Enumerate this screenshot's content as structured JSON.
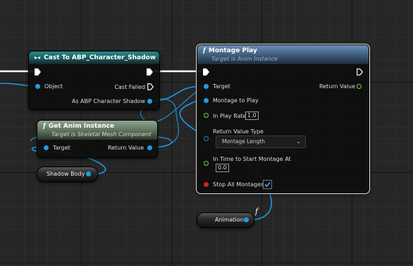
{
  "cast_node": {
    "title": "Cast To ABP_Character_Shadow",
    "object_pin": "Object",
    "cast_failed_pin": "Cast Failed",
    "as_pin": "As ABP Character Shadow",
    "header_icon": "cast-arrows-icon"
  },
  "get_anim_node": {
    "title": "Get Anim Instance",
    "subtitle": "Target is Skeletal Mesh Component",
    "target_pin": "Target",
    "return_pin": "Return Value",
    "header_icon": "function-icon"
  },
  "shadow_body": {
    "label": "Shadow Body"
  },
  "montage_node": {
    "title": "Montage Play",
    "subtitle": "Target is Anim Instance",
    "target_pin": "Target",
    "return_pin": "Return Value",
    "montage_to_play_pin": "Montage to Play",
    "in_play_rate_pin": "In Play Rate",
    "in_play_rate_value": "1.0",
    "return_value_type_pin": "Return Value Type",
    "return_value_type_value": "Montage Length",
    "in_time_pin": "In Time to Start Montage At",
    "in_time_value": "0.0",
    "stop_all_pin": "Stop All Montages",
    "stop_all_checked": true,
    "header_icon": "function-icon"
  },
  "animation_var": {
    "label": "Animation",
    "icon": "function-icon"
  },
  "colors": {
    "object_pin": "#1e9be8",
    "float_pin": "#7bd44a",
    "enum_pin": "#1e8a92",
    "cast_header": "#2a8b8b",
    "function_header": "#6a8fb4",
    "pure_function_header": "#8fa58f"
  }
}
